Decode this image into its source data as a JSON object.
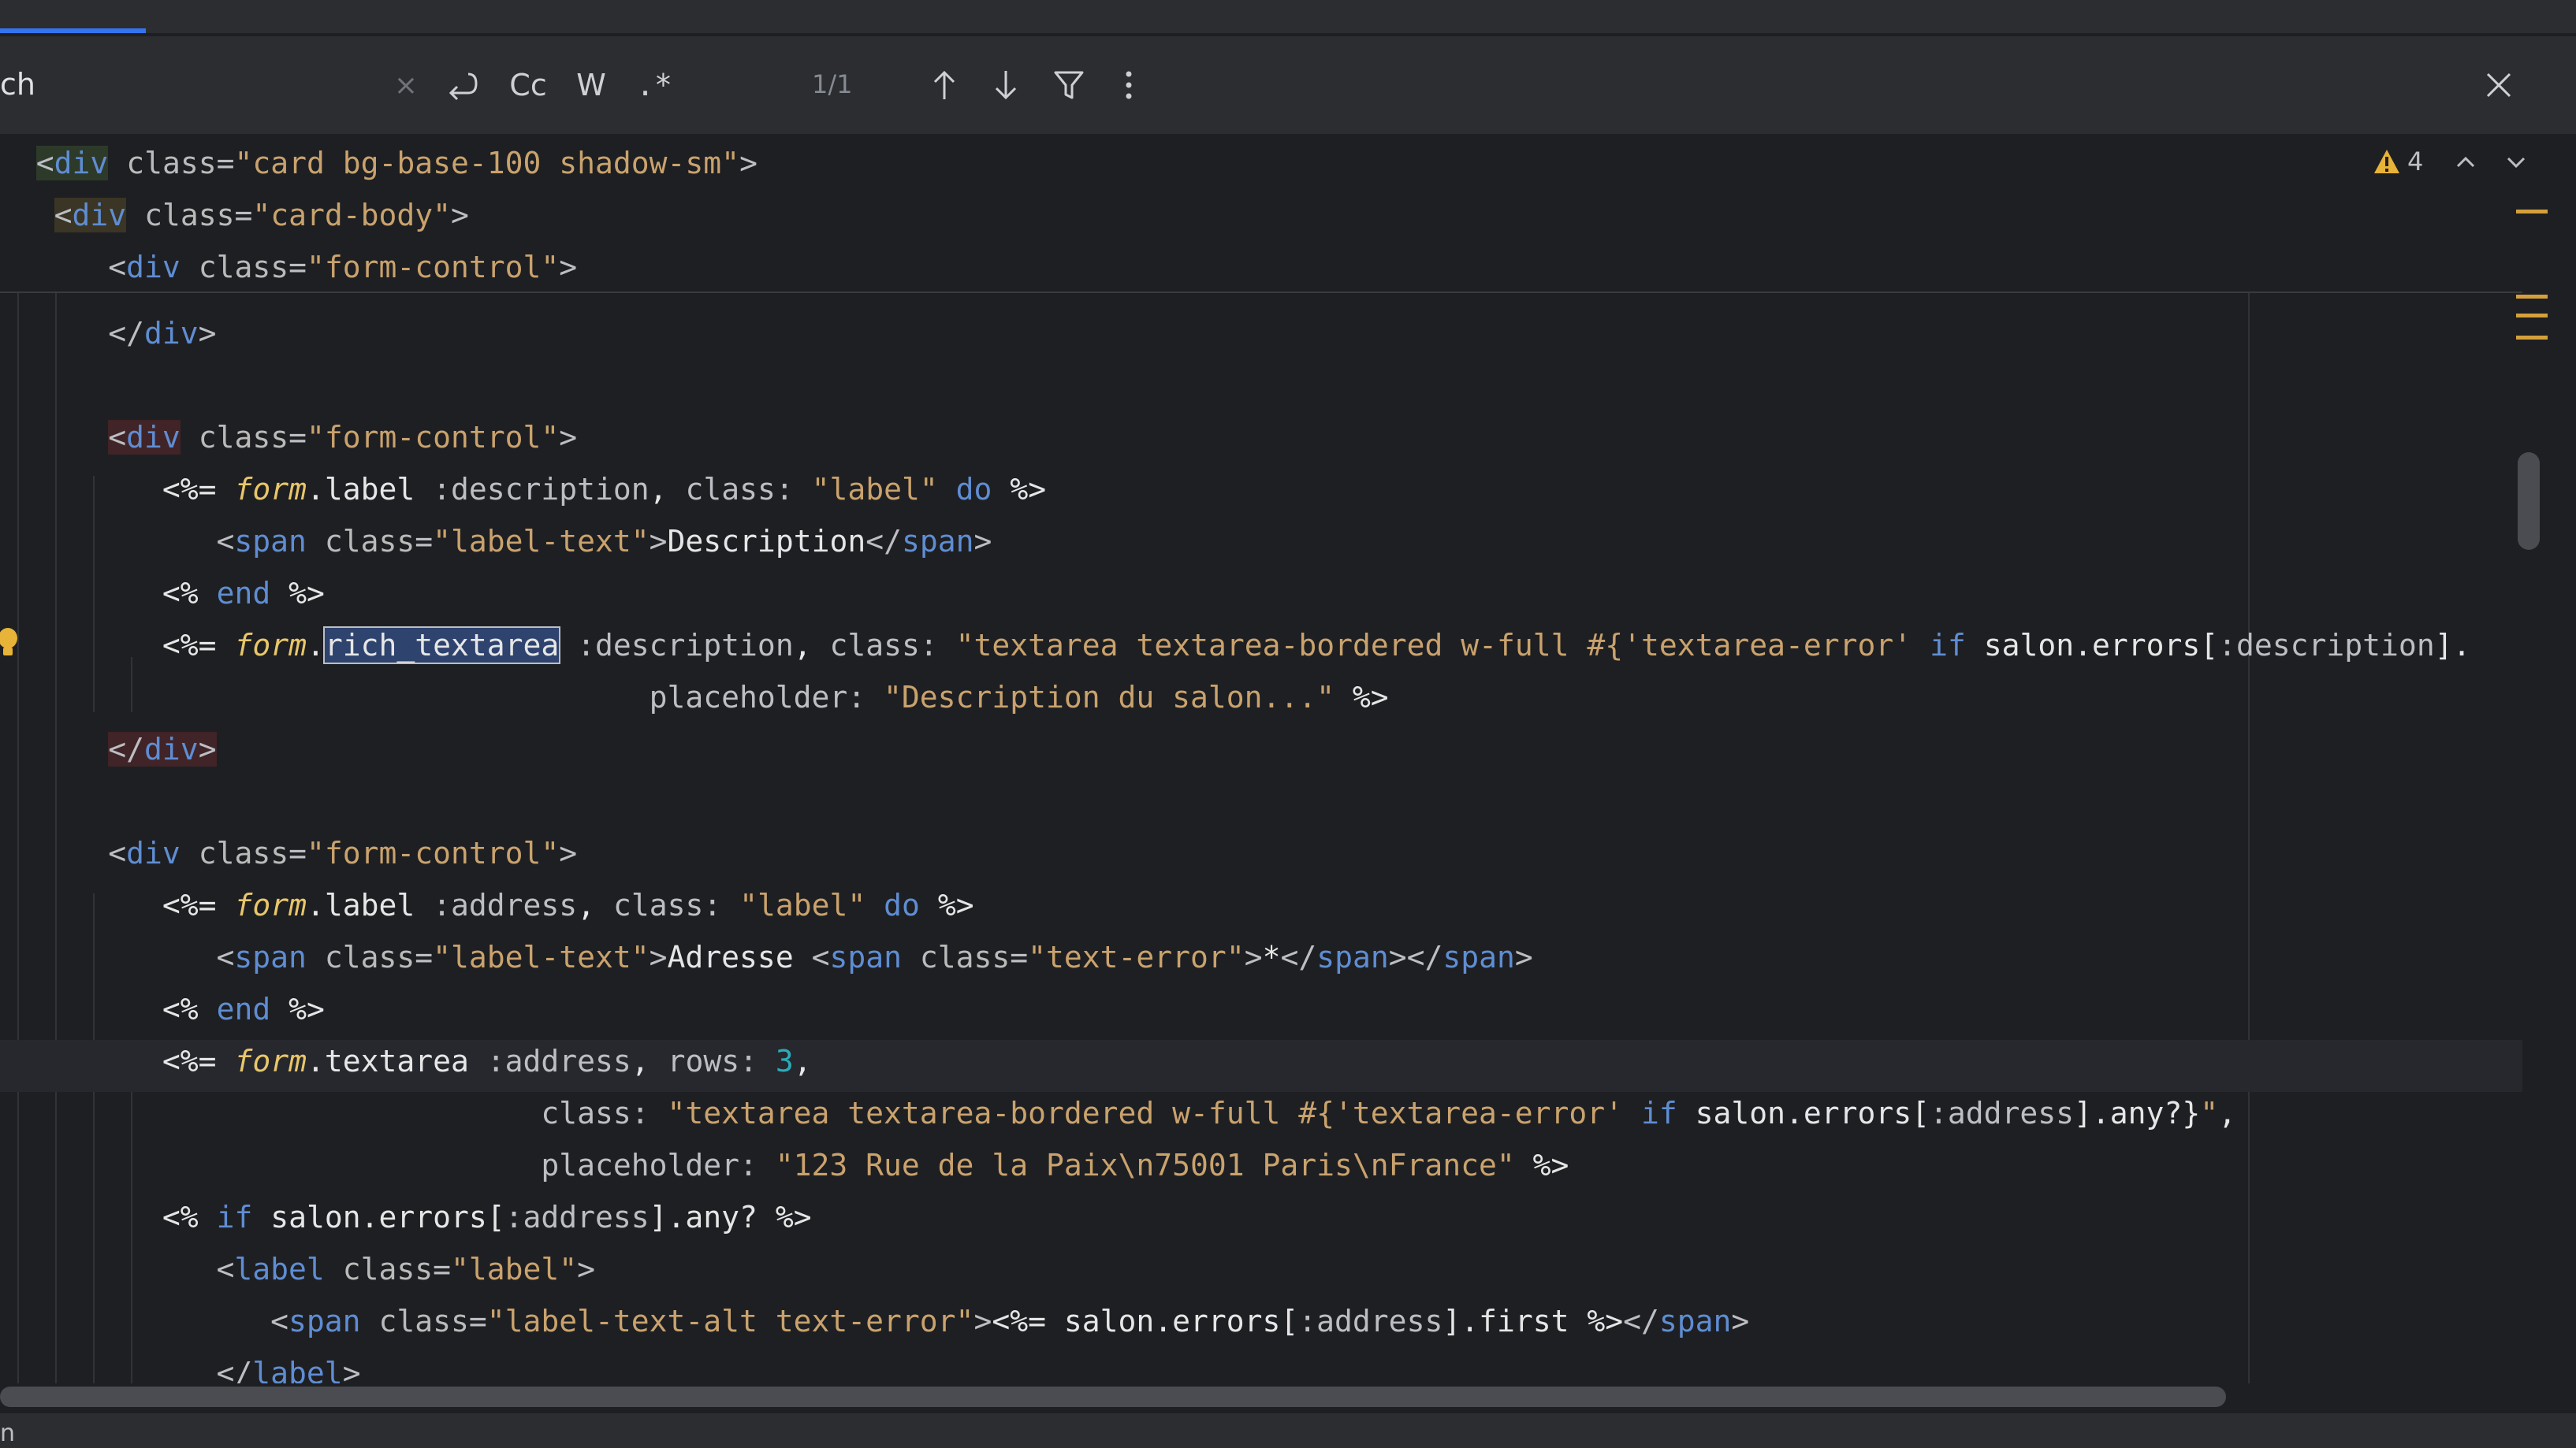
{
  "search": {
    "label": "ch",
    "regex_label": ".*",
    "case_label": "Cc",
    "word_label": "W",
    "match_count": "1/1"
  },
  "editor": {
    "warnings_count": "4",
    "status_text": "n"
  },
  "colors": {
    "accent": "#3574f0",
    "warning": "#d5a03c",
    "background": "#1e1f22"
  }
}
